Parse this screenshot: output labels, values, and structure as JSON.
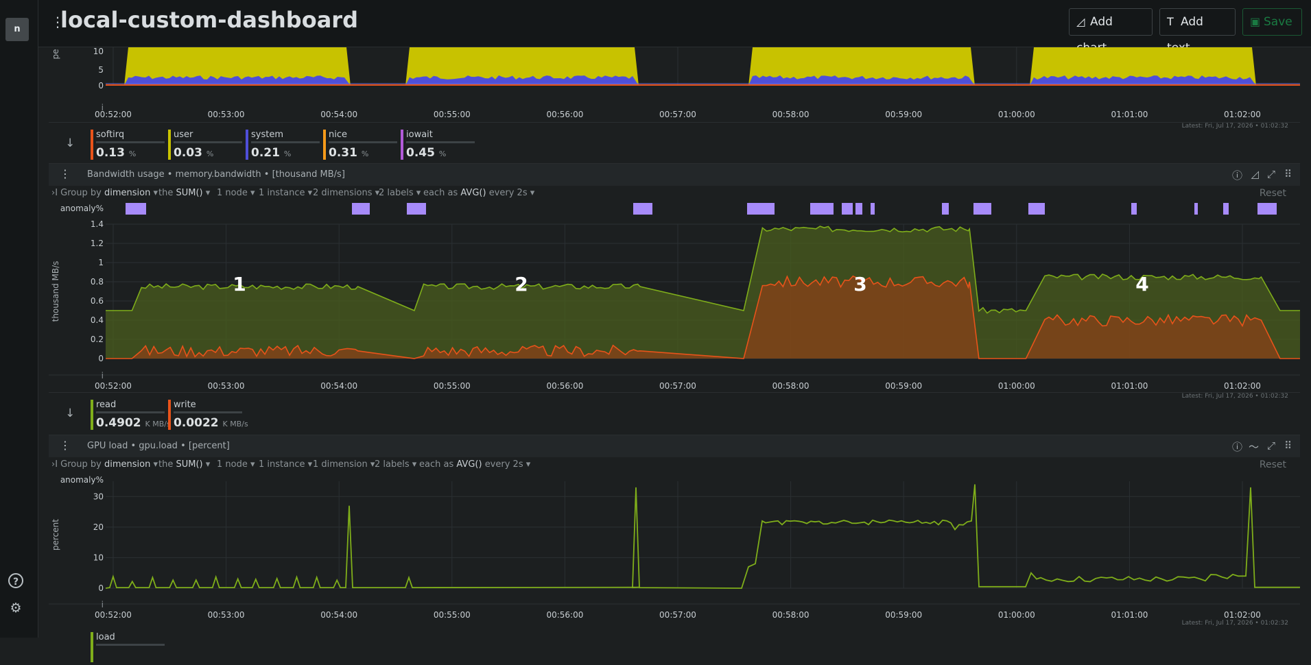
{
  "header": {
    "title": "local-custom-dashboard",
    "add_chart": "Add chart",
    "add_text": "Add text",
    "save": "Save"
  },
  "sidebar": {
    "logo": "n",
    "help_icon": "?",
    "settings_icon": "⚙"
  },
  "colors": {
    "bg": "#1c1f20",
    "yellow": "#c8c200",
    "blue": "#4f4fd8",
    "green": "#7fae1a",
    "orange": "#e8531a",
    "anomaly": "#a78bfa"
  },
  "xticks": [
    "00:52:00",
    "00:53:00",
    "00:54:00",
    "00:55:00",
    "00:56:00",
    "00:57:00",
    "00:58:00",
    "00:59:00",
    "01:00:00",
    "01:01:00",
    "01:02:00"
  ],
  "panel1": {
    "ylabel": "pe",
    "yticks": [
      "10",
      "5",
      "0"
    ],
    "latest": "Latest: Fri, Jul 17, 2026 • 01:02:32",
    "legend": [
      {
        "name": "softirq",
        "value": "0.13",
        "unit": "%",
        "color": "#e8531a"
      },
      {
        "name": "user",
        "value": "0.03",
        "unit": "%",
        "color": "#c8c200"
      },
      {
        "name": "system",
        "value": "0.21",
        "unit": "%",
        "color": "#4f4fd8"
      },
      {
        "name": "nice",
        "value": "0.31",
        "unit": "%",
        "color": "#f59a1a"
      },
      {
        "name": "iowait",
        "value": "0.45",
        "unit": "%",
        "color": "#b25ad8"
      }
    ]
  },
  "panel2": {
    "title": "Bandwidth usage • memory.bandwidth • [thousand MB/s]",
    "query": {
      "group_by": "Group by",
      "group_by_value": "dimension",
      "agg_prefix": "the",
      "agg": "SUM()",
      "nodes": "1 node",
      "instances": "1 instance",
      "dimensions": "2 dimensions",
      "labels": "2 labels",
      "each": "each as",
      "avg": "AVG()",
      "every": "every 2s",
      "reset": "Reset"
    },
    "anomaly_label": "anomaly%",
    "ylabel": "thousand MB/s",
    "yticks": [
      "1.4",
      "1.2",
      "1",
      "0.8",
      "0.6",
      "0.4",
      "0.2",
      "0"
    ],
    "annotations": [
      "1",
      "2",
      "3",
      "4"
    ],
    "latest": "Latest: Fri, Jul 17, 2026 • 01:02:32",
    "legend": [
      {
        "name": "read",
        "value": "0.4902",
        "unit": "K MB/s",
        "color": "#7fae1a"
      },
      {
        "name": "write",
        "value": "0.0022",
        "unit": "K MB/s",
        "color": "#e8531a"
      }
    ]
  },
  "panel3": {
    "title": "GPU load • gpu.load • [percent]",
    "query": {
      "group_by": "Group by",
      "group_by_value": "dimension",
      "agg_prefix": "the",
      "agg": "SUM()",
      "nodes": "1 node",
      "instances": "1 instance",
      "dimensions": "1 dimension",
      "labels": "2 labels",
      "each": "each as",
      "avg": "AVG()",
      "every": "every 2s",
      "reset": "Reset"
    },
    "anomaly_label": "anomaly%",
    "ylabel": "percent",
    "yticks": [
      "30",
      "20",
      "10",
      "0"
    ],
    "latest": "Latest: Fri, Jul 17, 2026 • 01:02:32",
    "legend": [
      {
        "name": "load",
        "color": "#7fae1a"
      }
    ]
  },
  "chart_data": [
    {
      "type": "area",
      "ylabel": "pe",
      "series": [
        {
          "name": "user",
          "values": [
            0,
            12,
            12,
            0,
            0,
            12,
            12,
            0,
            0,
            0,
            12,
            12,
            0,
            0,
            12,
            12,
            0
          ]
        },
        {
          "name": "system",
          "values": [
            0,
            2,
            2,
            0,
            0,
            2,
            2,
            0,
            0,
            0,
            2,
            2,
            0,
            0,
            2,
            2,
            0
          ]
        },
        {
          "name": "softirq",
          "values": [
            0,
            0.1,
            0.1,
            0,
            0,
            0.1,
            0.1,
            0,
            0,
            0,
            0.1,
            0.1,
            0,
            0,
            0.1,
            0.1,
            0
          ]
        }
      ]
    },
    {
      "type": "area",
      "title": "Bandwidth usage • memory.bandwidth • [thousand MB/s]",
      "ylabel": "thousand MB/s",
      "ylim": [
        0,
        1.4
      ],
      "x": [
        "00:52:10",
        "00:52:15",
        "00:54:10",
        "00:54:40",
        "00:54:45",
        "00:56:40",
        "00:57:35",
        "00:57:45",
        "00:59:35",
        "00:59:40",
        "01:00:05",
        "01:00:15",
        "01:02:10",
        "01:02:20"
      ],
      "series": [
        {
          "name": "read",
          "values": [
            0.5,
            0.75,
            0.75,
            0.5,
            0.75,
            0.75,
            0.5,
            1.35,
            1.35,
            0.5,
            0.5,
            0.85,
            0.85,
            0.5
          ]
        },
        {
          "name": "write",
          "values": [
            0,
            0.08,
            0.08,
            0,
            0.08,
            0.08,
            0,
            0.8,
            0.8,
            0,
            0,
            0.4,
            0.4,
            0
          ]
        }
      ]
    },
    {
      "type": "line",
      "title": "GPU load • gpu.load • [percent]",
      "ylabel": "percent",
      "ylim": [
        0,
        35
      ],
      "x": [
        "00:52:00",
        "00:54:05",
        "00:54:10",
        "00:54:15",
        "00:56:35",
        "00:56:40",
        "00:56:45",
        "00:57:35",
        "00:57:45",
        "00:59:35",
        "00:59:40",
        "00:59:45",
        "01:00:10",
        "01:02:05",
        "01:02:10",
        "01:02:15"
      ],
      "series": [
        {
          "name": "load",
          "values": [
            0,
            0,
            27,
            0,
            0,
            33,
            0,
            0,
            22,
            22,
            34,
            0,
            3,
            4,
            33,
            0
          ]
        }
      ]
    }
  ]
}
